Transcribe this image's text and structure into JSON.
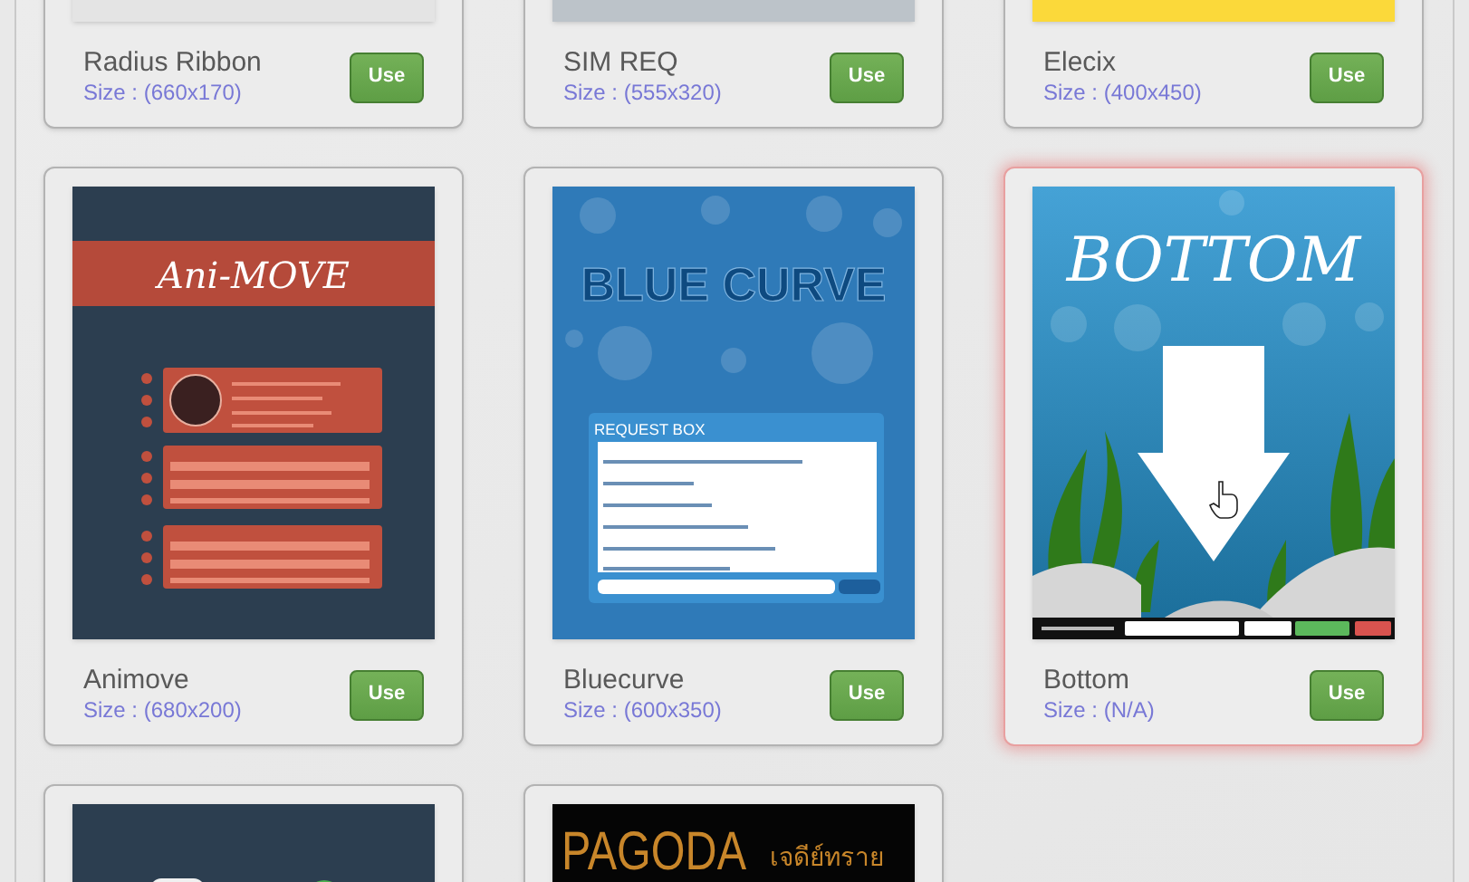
{
  "cards": [
    {
      "name": "Radius Ribbon",
      "size": "Size : (660x170)",
      "selected": false,
      "button": "Use",
      "preview": {
        "kind": "strip",
        "color": "#e4e4e4"
      }
    },
    {
      "name": "SIM REQ",
      "size": "Size : (555x320)",
      "selected": false,
      "button": "Use",
      "preview": {
        "kind": "strip",
        "color": "#bcc3c9"
      }
    },
    {
      "name": "Elecix",
      "size": "Size : (400x450)",
      "selected": false,
      "button": "Use",
      "preview": {
        "kind": "strip",
        "color": "#fbd93a"
      }
    },
    {
      "name": "Animove",
      "size": "Size : (680x200)",
      "selected": false,
      "button": "Use",
      "preview": {
        "kind": "animove",
        "title": "Ani-MOVE"
      }
    },
    {
      "name": "Bluecurve",
      "size": "Size : (600x350)",
      "selected": false,
      "button": "Use",
      "preview": {
        "kind": "bluecurve",
        "title": "BLUE CURVE",
        "box_title": "REQUEST BOX"
      }
    },
    {
      "name": "Bottom",
      "size": "Size : (N/A)",
      "selected": true,
      "button": "Use",
      "preview": {
        "kind": "bottom",
        "title": "BOTTOM"
      }
    },
    {
      "selected": false,
      "preview": {
        "kind": "dark"
      }
    },
    {
      "selected": false,
      "preview": {
        "kind": "pagoda",
        "title": "PAGODA",
        "subtitle": "เจดีย์ทราย"
      }
    }
  ]
}
